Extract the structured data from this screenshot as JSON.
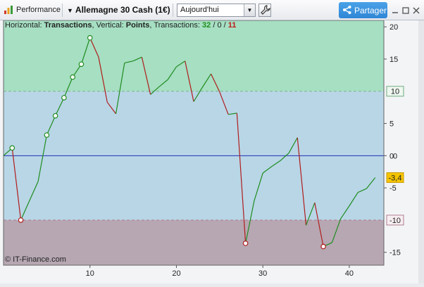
{
  "toolbar": {
    "title": "Performance",
    "instrument": "Allemagne 30 Cash (1€)",
    "period": "Aujourd'hui",
    "share_label": "Partager"
  },
  "legend": {
    "horizontal_label": "Horizontal: ",
    "horizontal_value": "Transactions",
    "vertical_label": ", Vertical: ",
    "vertical_value": "Points",
    "transactions_label": ", Transactions: ",
    "wins": "32",
    "sep1": " / ",
    "neutral": "0",
    "sep2": " / ",
    "losses": "11"
  },
  "copyright": "© IT-Finance.com",
  "colors": {
    "zone_high": "#a6dfc2",
    "zone_mid": "#b8d6e6",
    "zone_low": "#b6a7b2",
    "up": "#1f8c1f",
    "down": "#b01c1c",
    "zero_line": "#2130b8",
    "last_badge": "#f5c400"
  },
  "chart_data": {
    "type": "line",
    "xlabel": "",
    "ylabel": "",
    "xlim": [
      0,
      44
    ],
    "ylim": [
      -17,
      21
    ],
    "x_ticks": [
      10,
      20,
      30,
      40
    ],
    "y_ticks": [
      20,
      15,
      5,
      0,
      -5,
      -15
    ],
    "levels": {
      "upper": 10,
      "lower": -10,
      "last": -3.4
    },
    "level_labels": {
      "upper": "10",
      "lower": "-10",
      "zero": "0",
      "last": "-3,4"
    },
    "grid": false,
    "points": [
      [
        0,
        0
      ],
      [
        1,
        1.2
      ],
      [
        2,
        -10
      ],
      [
        3,
        -7
      ],
      [
        4,
        -4
      ],
      [
        5,
        3.2
      ],
      [
        6,
        6.2
      ],
      [
        7,
        9
      ],
      [
        8,
        12.2
      ],
      [
        9,
        14.2
      ],
      [
        10,
        18.3
      ],
      [
        11,
        15.3
      ],
      [
        12,
        8.3
      ],
      [
        13,
        6.5
      ],
      [
        14,
        14.4
      ],
      [
        15,
        14.7
      ],
      [
        16,
        15.3
      ],
      [
        17,
        9.5
      ],
      [
        18,
        10.7
      ],
      [
        19,
        11.8
      ],
      [
        20,
        13.8
      ],
      [
        21,
        14.7
      ],
      [
        22,
        8.4
      ],
      [
        23,
        10.6
      ],
      [
        24,
        12.7
      ],
      [
        25,
        9.9
      ],
      [
        26,
        6.4
      ],
      [
        27,
        6.6
      ],
      [
        28,
        -13.6
      ],
      [
        29,
        -7
      ],
      [
        30,
        -2.7
      ],
      [
        31,
        -1.7
      ],
      [
        32,
        -0.8
      ],
      [
        33,
        0.4
      ],
      [
        34,
        2.8
      ],
      [
        35,
        -10.8
      ],
      [
        36,
        -7.3
      ],
      [
        37,
        -14.1
      ],
      [
        38,
        -13.5
      ],
      [
        39,
        -9.8
      ],
      [
        40,
        -7.8
      ],
      [
        41,
        -5.7
      ],
      [
        42,
        -5.1
      ],
      [
        43,
        -3.4
      ]
    ],
    "markers": [
      1,
      2,
      5,
      6,
      7,
      8,
      9,
      10,
      28,
      37
    ]
  }
}
